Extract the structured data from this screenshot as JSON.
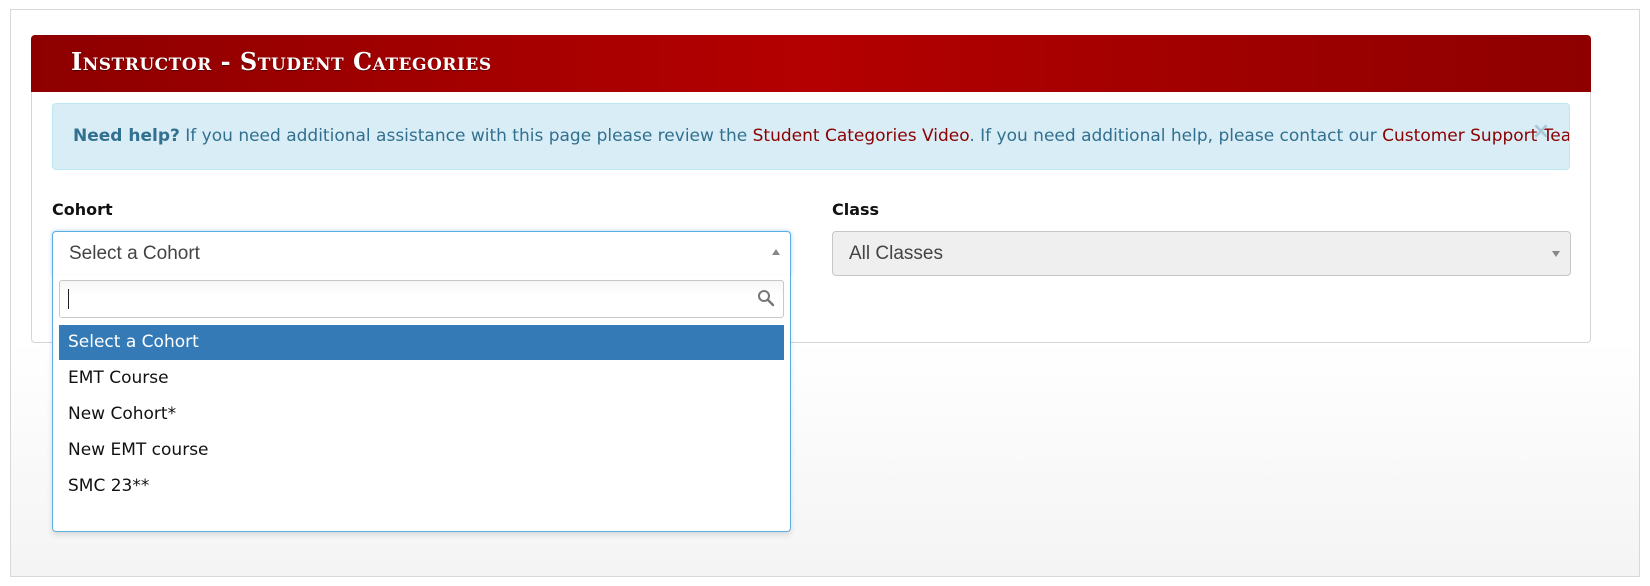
{
  "header": {
    "title": "Instructor - Student Categories"
  },
  "help": {
    "strong": "Need help?",
    "text_before": " If you need additional assistance with this page please review the ",
    "video_link": "Student Categories Video",
    "text_middle": ". If you need additional help, please contact our ",
    "support_link": "Customer Support Team",
    "text_after": ".",
    "close_label": "×"
  },
  "cohort": {
    "label": "Cohort",
    "selected": "Select a Cohort",
    "search_value": "",
    "options": [
      {
        "label": "Select a Cohort",
        "highlighted": true
      },
      {
        "label": "EMT Course"
      },
      {
        "label": "New Cohort*"
      },
      {
        "label": "New EMT course"
      },
      {
        "label": "SMC 23**"
      }
    ]
  },
  "class": {
    "label": "Class",
    "selected": "All Classes"
  },
  "colors": {
    "header_red": "#b40000",
    "alert_bg": "#d9edf7",
    "alert_text": "#31708f",
    "link": "#8b0000",
    "highlight": "#337ab7"
  }
}
